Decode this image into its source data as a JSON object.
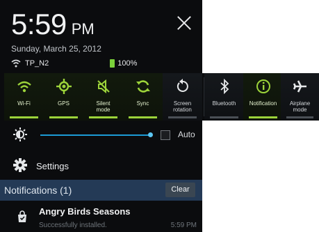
{
  "clock": {
    "time": "5:59",
    "ampm": "PM",
    "date": "Sunday, March 25, 2012"
  },
  "status": {
    "ssid": "TP_N2",
    "battery": "100%",
    "battery_color": "#7bd13b"
  },
  "toggles": [
    {
      "label": "Wi-Fi",
      "icon": "wifi-icon",
      "on": true
    },
    {
      "label": "GPS",
      "icon": "gps-icon",
      "on": true
    },
    {
      "label": "Silent\nmode",
      "icon": "silent-mode-icon",
      "on": true
    },
    {
      "label": "Sync",
      "icon": "sync-icon",
      "on": true
    },
    {
      "label": "Screen\nrotation",
      "icon": "screen-rotation-icon",
      "on": false
    },
    {
      "label": "Bluetooth",
      "icon": "bluetooth-icon",
      "on": false
    },
    {
      "label": "Notification",
      "icon": "notification-icon",
      "on": true
    },
    {
      "label": "Airplane\nmode",
      "icon": "airplane-icon",
      "on": false
    }
  ],
  "brightness": {
    "auto_label": "Auto",
    "level_percent": 100,
    "auto_checked": false,
    "accent": "#1c9bd5"
  },
  "settings": {
    "label": "Settings"
  },
  "notifications": {
    "header": "Notifications (1)",
    "clear_label": "Clear",
    "items": [
      {
        "title": "Angry Birds Seasons",
        "subtitle": "Successfully installed.",
        "time": "5:59 PM"
      }
    ]
  }
}
